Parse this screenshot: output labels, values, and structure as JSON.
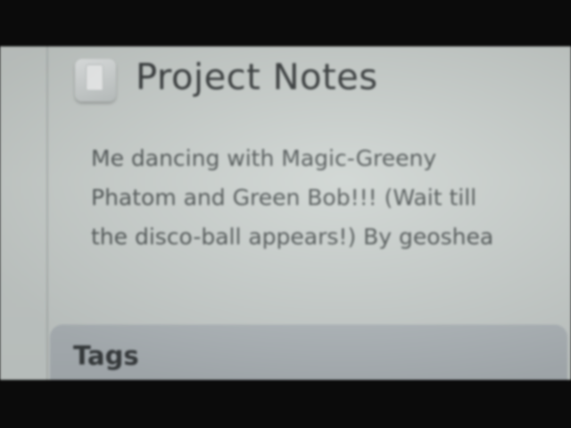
{
  "notes": {
    "icon": "notes-icon",
    "title": "Project Notes",
    "description": "Me dancing with Magic-Greeny Phatom and Green Bob!!! (Wait till the disco-ball appears!) By geoshea"
  },
  "tags": {
    "heading": "Tags"
  }
}
